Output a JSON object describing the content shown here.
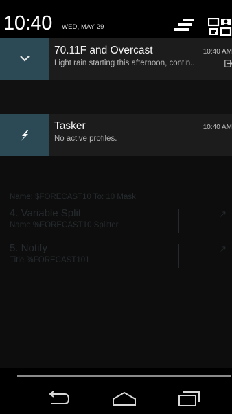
{
  "status": {
    "time": "10:40",
    "date": "WED, MAY 29"
  },
  "notifications": [
    {
      "title": "70.11F and Overcast",
      "body": "Light rain starting this afternoon, contin..",
      "time": "10:40 AM",
      "icon": "chevron-down-icon",
      "tile_color": "#2b4a55"
    },
    {
      "title": "Tasker",
      "body": "No active profiles.",
      "time": "10:40 AM",
      "icon": "lightning-bolt-icon",
      "tile_color": "#2b4a55"
    }
  ],
  "background_app": {
    "top_line": "Name: $FORECAST10 To: 10 Mask",
    "steps": [
      {
        "title": "4. Variable Split",
        "sub": "Name %FORECAST10 Splitter"
      },
      {
        "title": "5. Notify",
        "sub": "Title %FORECAST101"
      }
    ]
  },
  "nav": {
    "back": "back-icon",
    "home": "home-icon",
    "recents": "recents-icon"
  }
}
